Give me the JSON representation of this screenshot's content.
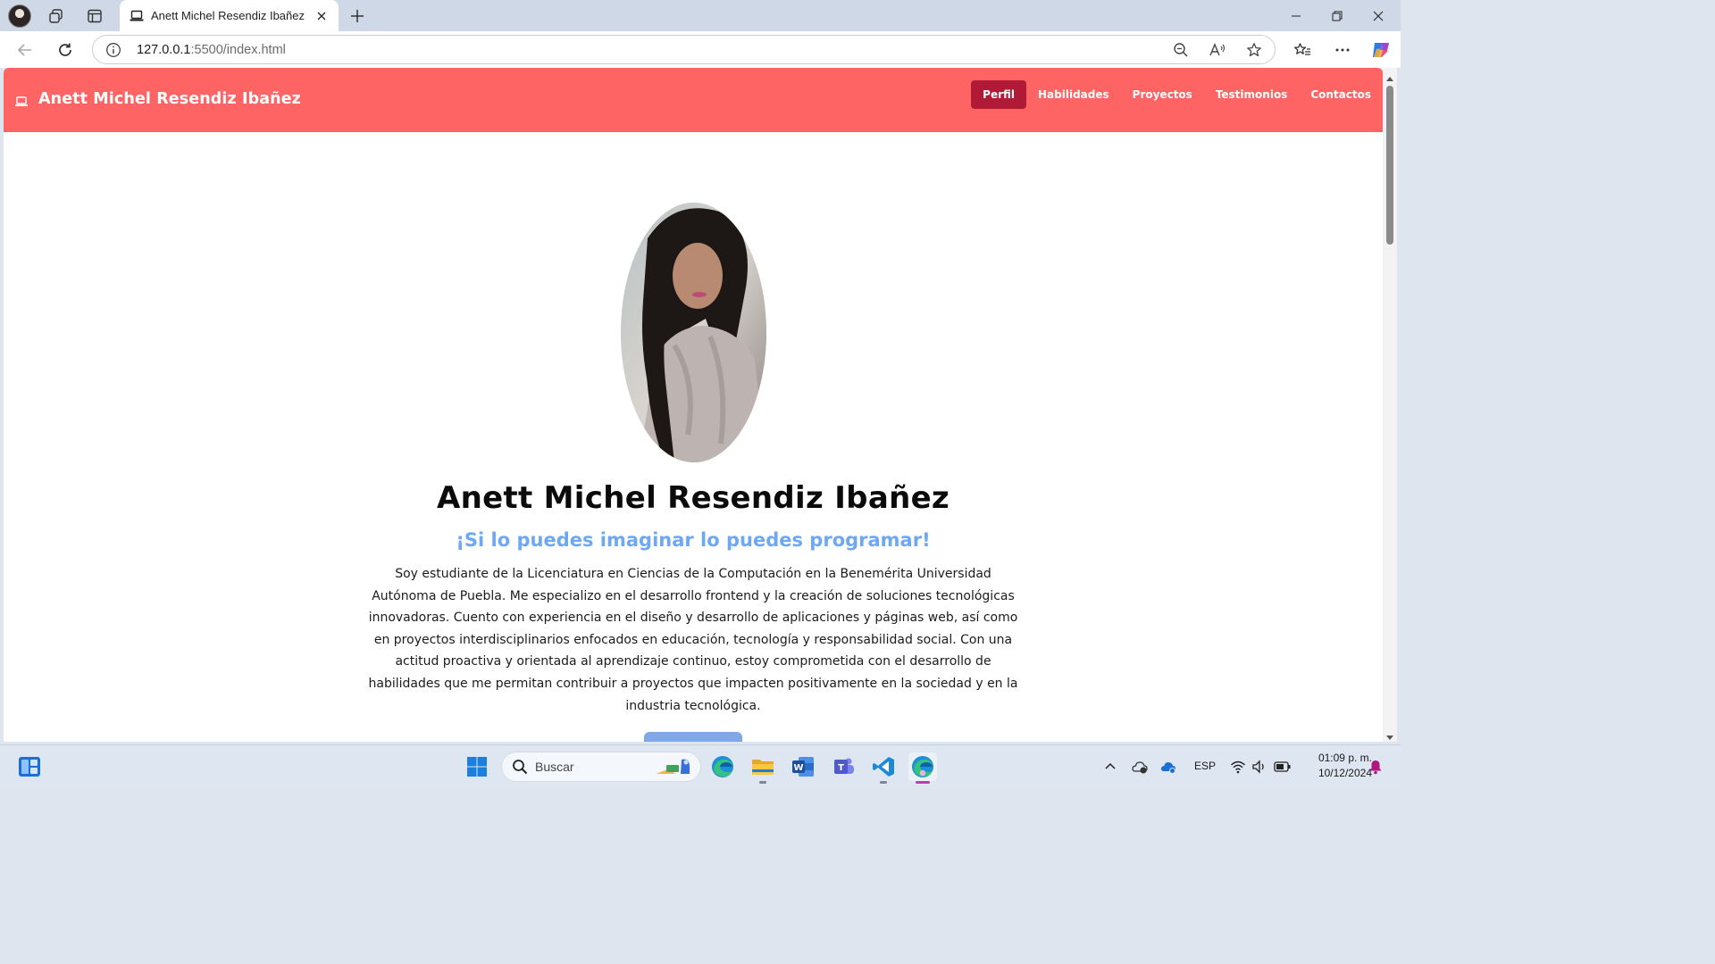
{
  "browser": {
    "tab": {
      "title": "Anett Michel Resendiz Ibañez",
      "favicon": "laptop-icon"
    },
    "url": {
      "host": "127.0.0.1",
      "path": ":5500/index.html"
    },
    "icons": {
      "back": "back-arrow-icon",
      "reload": "reload-icon",
      "site_info": "info-icon",
      "zoom": "zoom-out-icon",
      "read_aloud": "read-aloud-icon",
      "favorite": "star-icon",
      "favorites": "favorites-icon",
      "more": "more-icon",
      "copilot": "copilot-icon"
    }
  },
  "site": {
    "brand": {
      "icon": "laptop-icon",
      "name": "Anett Michel Resendiz Ibañez"
    },
    "nav": [
      {
        "label": "Perfil",
        "active": true
      },
      {
        "label": "Habilidades",
        "active": false
      },
      {
        "label": "Proyectos",
        "active": false
      },
      {
        "label": "Testimonios",
        "active": false
      },
      {
        "label": "Contactos",
        "active": false
      }
    ],
    "profile": {
      "name": "Anett Michel Resendiz Ibañez",
      "tagline": "¡Si lo puedes imaginar lo puedes programar!",
      "bio_lines": [
        "Soy estudiante de la Licenciatura en Ciencias de la Computación en la Benemérita Universidad",
        "Autónoma de Puebla. Me especializo en el desarrollo frontend y la creación de soluciones tecnológicas",
        "innovadoras. Cuento con experiencia en el diseño y desarrollo de aplicaciones y páginas web, así como",
        "en proyectos interdisciplinarios enfocados en educación, tecnología y responsabilidad social. Con una",
        "actitud proactiva y orientada al aprendizaje continuo, estoy comprometida con el desarrollo de",
        "habilidades que me permitan contribuir a proyectos que impacten positivamente en la sociedad y en la",
        "industria tecnológica."
      ]
    },
    "colors": {
      "navbar": "#ff6464",
      "nav_active": "#b01a37",
      "tagline": "#6ea8f2",
      "button": "#80a8e6"
    }
  },
  "taskbar": {
    "search_label": "Buscar",
    "apps": [
      "widgets-icon",
      "windows-start-icon",
      "edge-icon",
      "file-explorer-icon",
      "word-icon",
      "teams-icon",
      "vscode-icon",
      "edge-active-icon"
    ],
    "language": "ESP",
    "time": "01:09 p. m.",
    "date": "10/12/2024"
  }
}
